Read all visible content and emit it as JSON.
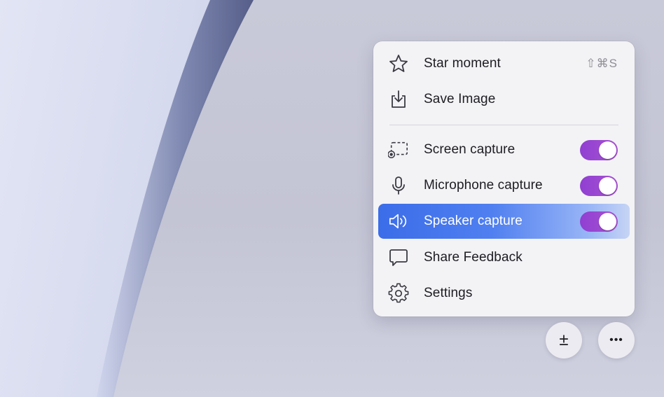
{
  "menu": {
    "items": [
      {
        "label": "Star moment",
        "icon": "star-icon",
        "shortcut": "⇧⌘S"
      },
      {
        "label": "Save Image",
        "icon": "save-image-icon"
      },
      {
        "label": "Screen capture",
        "icon": "screen-capture-icon",
        "toggle": true
      },
      {
        "label": "Microphone capture",
        "icon": "microphone-icon",
        "toggle": true
      },
      {
        "label": "Speaker capture",
        "icon": "speaker-icon",
        "toggle": true,
        "highlighted": true
      },
      {
        "label": "Share Feedback",
        "icon": "chat-bubble-icon"
      },
      {
        "label": "Settings",
        "icon": "gear-icon"
      }
    ]
  },
  "buttons": {
    "plus_minus": "±",
    "more": "•••"
  },
  "colors": {
    "toggle_on": "#9b47d3",
    "highlight": "#3c6de9",
    "menu_bg": "#f3f3f6"
  }
}
